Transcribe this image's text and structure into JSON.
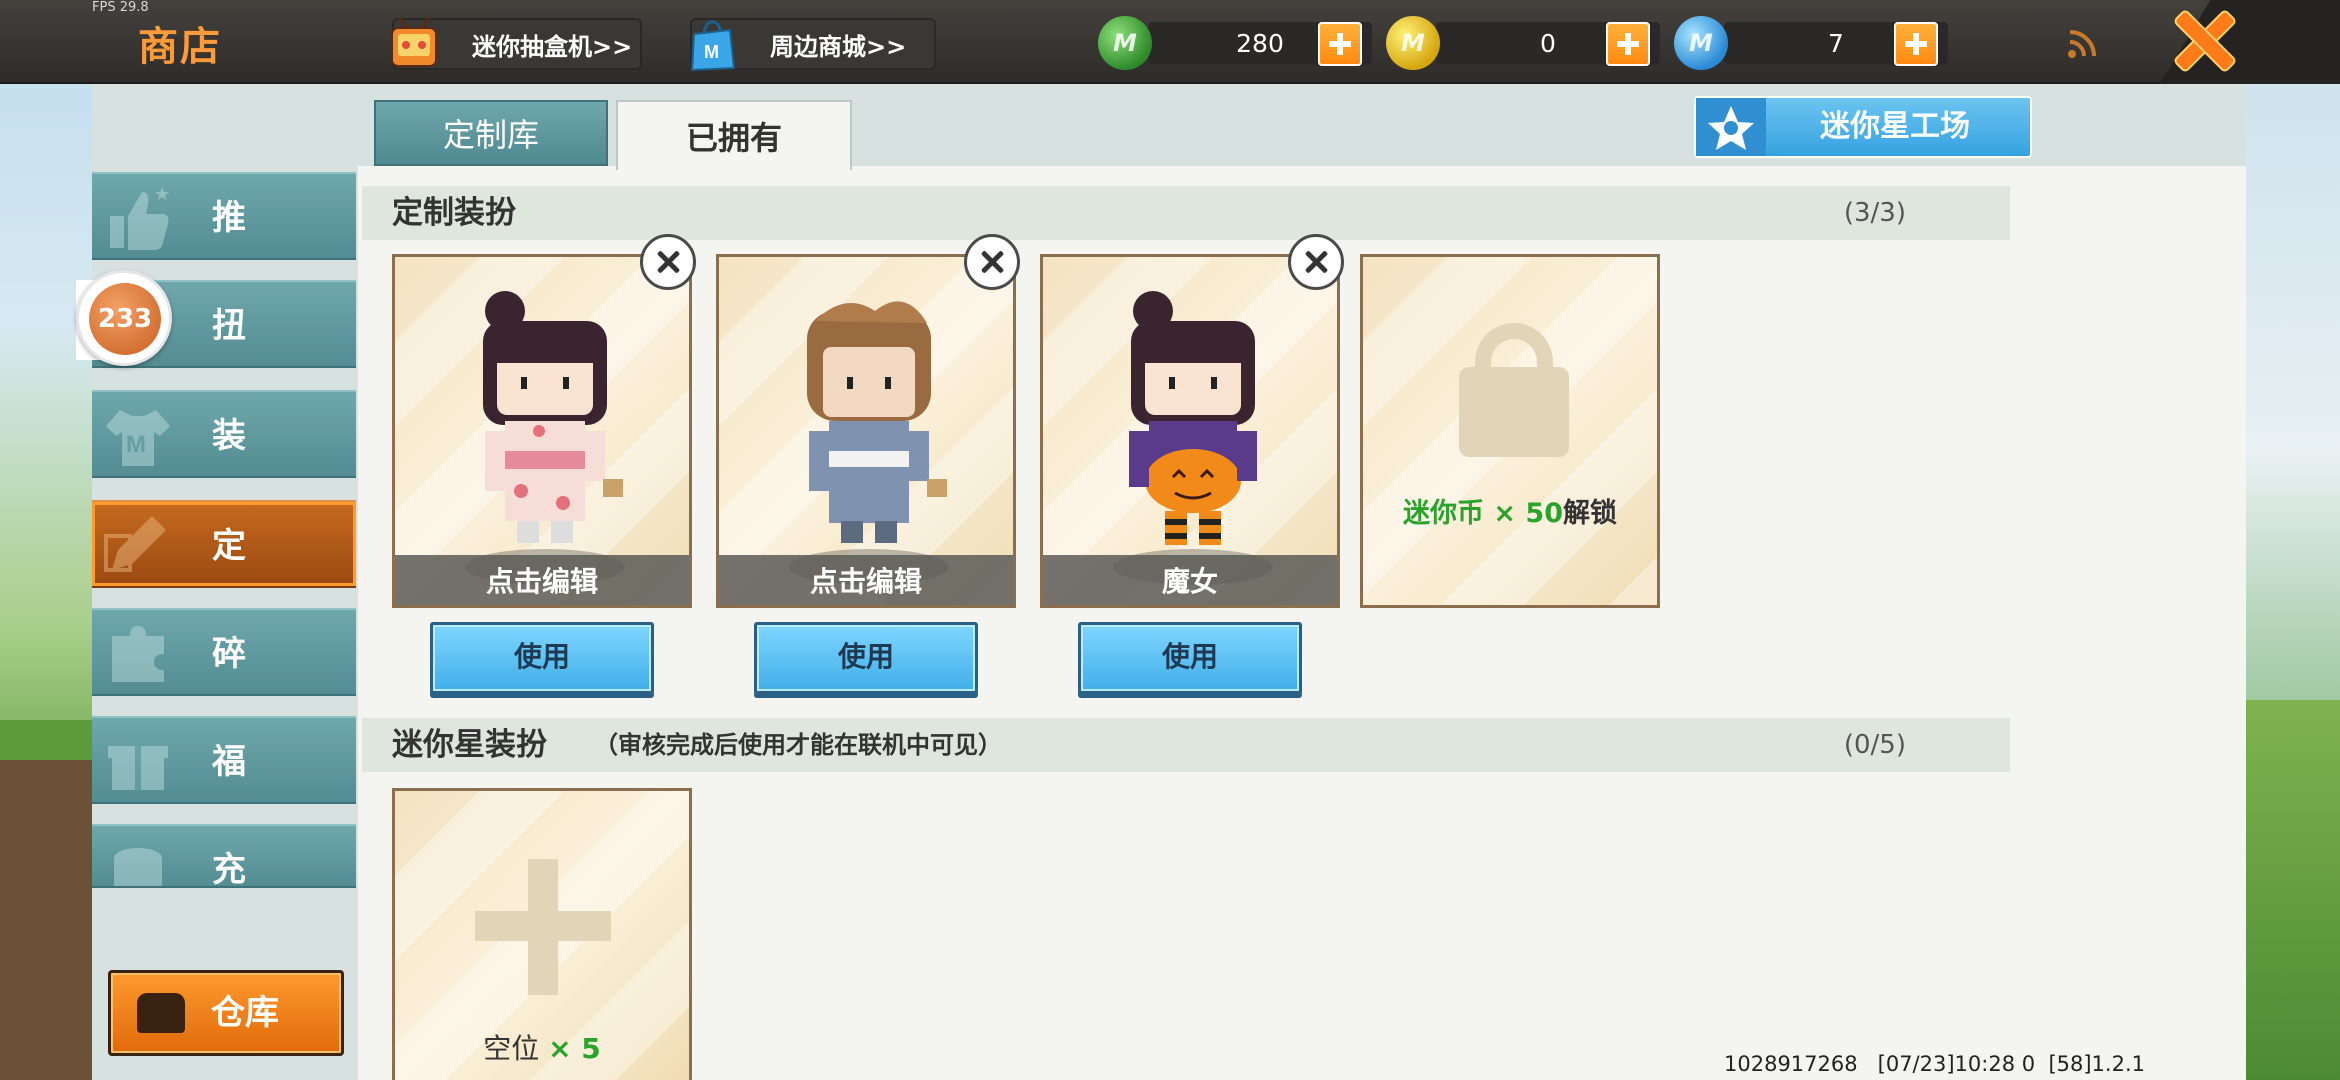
{
  "status": {
    "fps": "FPS 29.8"
  },
  "header": {
    "title": "商店",
    "blindbox_link": "迷你抽盒机>>",
    "mall_link": "周边商城>>",
    "currencies": [
      {
        "name": "green-gem",
        "value": "280",
        "color": "#3da33a"
      },
      {
        "name": "mini-coin",
        "value": "0",
        "color": "#e6b81e"
      },
      {
        "name": "mini-bean",
        "value": "7",
        "color": "#3a9be0"
      }
    ]
  },
  "sidebar": {
    "badge": "233",
    "items": [
      {
        "label": "推荐",
        "icon": "thumbs-up-icon"
      },
      {
        "label": "扭蛋",
        "icon": "capsule-icon"
      },
      {
        "label": "装扮",
        "icon": "shirt-icon"
      },
      {
        "label": "定制",
        "icon": "pencil-icon",
        "active": true
      },
      {
        "label": "碎片",
        "icon": "puzzle-icon"
      },
      {
        "label": "福利",
        "icon": "gift-icon"
      },
      {
        "label": "充值",
        "icon": "coins-icon"
      }
    ],
    "warehouse": "仓库"
  },
  "tabs": {
    "library": "定制库",
    "owned": "已拥有"
  },
  "workshop_button": "迷你星工场",
  "custom_section": {
    "title": "定制装扮",
    "count": "(3/3)",
    "cards": [
      {
        "label": "点击编辑",
        "use": "使用"
      },
      {
        "label": "点击编辑",
        "use": "使用"
      },
      {
        "label": "魔女",
        "use": "使用"
      }
    ],
    "locked": {
      "prefix": "迷你币 × 50",
      "suffix": "解锁"
    }
  },
  "star_section": {
    "title": "迷你星装扮",
    "subtitle": "（审核完成后使用才能在联机中可见）",
    "count": "(0/5)",
    "slot": {
      "prefix": "空位 ",
      "count": "× 5"
    }
  },
  "footer": "1028917268   [07/23]10:28 0  [58]1.2.1",
  "colors": {
    "accent_orange": "#ff9a2e",
    "teal": "#5f9aa0",
    "use_blue": "#40aee8"
  }
}
